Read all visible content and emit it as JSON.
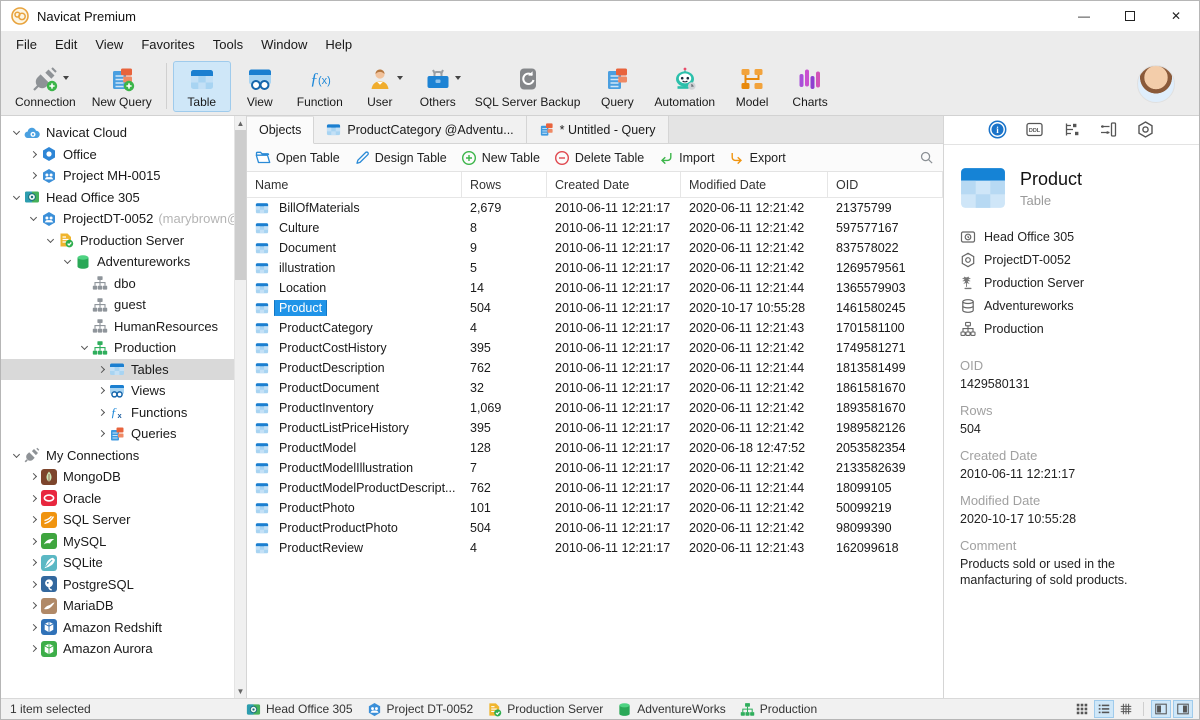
{
  "window": {
    "title": "Navicat Premium",
    "controls": {
      "minimize": "minimize",
      "maximize": "maximize",
      "close": "close"
    }
  },
  "menu": {
    "items": [
      "File",
      "Edit",
      "View",
      "Favorites",
      "Tools",
      "Window",
      "Help"
    ]
  },
  "toolbar": {
    "buttons": [
      {
        "label": "Connection",
        "icon": "connection",
        "caret": true,
        "active": false
      },
      {
        "label": "New Query",
        "icon": "new-query",
        "caret": false,
        "active": false
      },
      {
        "label": "Table",
        "icon": "table-lg",
        "caret": false,
        "active": true
      },
      {
        "label": "View",
        "icon": "view-lg",
        "caret": false,
        "active": false
      },
      {
        "label": "Function",
        "icon": "function",
        "caret": false,
        "active": false
      },
      {
        "label": "User",
        "icon": "user",
        "caret": true,
        "active": false
      },
      {
        "label": "Others",
        "icon": "others",
        "caret": true,
        "active": false
      },
      {
        "label": "SQL Server Backup",
        "icon": "backup",
        "caret": false,
        "active": false
      },
      {
        "label": "Query",
        "icon": "query",
        "caret": false,
        "active": false
      },
      {
        "label": "Automation",
        "icon": "automation",
        "caret": false,
        "active": false
      },
      {
        "label": "Model",
        "icon": "model",
        "caret": false,
        "active": false
      },
      {
        "label": "Charts",
        "icon": "charts",
        "caret": false,
        "active": false
      }
    ]
  },
  "sidebar": {
    "items": [
      {
        "label": "Navicat Cloud",
        "icon": "cloud",
        "depth": 0,
        "chevron": "down",
        "selected": false
      },
      {
        "label": "Office",
        "icon": "hex-office",
        "depth": 1,
        "chevron": "right",
        "selected": false
      },
      {
        "label": "Project MH-0015",
        "icon": "project",
        "depth": 1,
        "chevron": "right",
        "selected": false
      },
      {
        "label": "Head Office 305",
        "icon": "headoffice",
        "depth": 0,
        "chevron": "down",
        "selected": false
      },
      {
        "label": "ProjectDT-0052",
        "secondary": "(marybrown@",
        "icon": "project",
        "depth": 1,
        "chevron": "down",
        "selected": false
      },
      {
        "label": "Production Server",
        "icon": "prodserver",
        "depth": 2,
        "chevron": "down",
        "selected": false
      },
      {
        "label": "Adventureworks",
        "icon": "db-green",
        "depth": 3,
        "chevron": "down",
        "selected": false
      },
      {
        "label": "dbo",
        "icon": "schema-gray",
        "depth": 4,
        "chevron": "none",
        "selected": false
      },
      {
        "label": "guest",
        "icon": "schema-gray",
        "depth": 4,
        "chevron": "none",
        "selected": false
      },
      {
        "label": "HumanResources",
        "icon": "schema-gray",
        "depth": 4,
        "chevron": "none",
        "selected": false
      },
      {
        "label": "Production",
        "icon": "schema-green",
        "depth": 4,
        "chevron": "down",
        "selected": false
      },
      {
        "label": "Tables",
        "icon": "table",
        "depth": 5,
        "chevron": "right",
        "selected": true
      },
      {
        "label": "Views",
        "icon": "view",
        "depth": 5,
        "chevron": "right",
        "selected": false
      },
      {
        "label": "Functions",
        "icon": "functions",
        "depth": 5,
        "chevron": "right",
        "selected": false
      },
      {
        "label": "Queries",
        "icon": "queries",
        "depth": 5,
        "chevron": "right",
        "selected": false
      },
      {
        "label": "My Connections",
        "icon": "plug",
        "depth": 0,
        "chevron": "down",
        "selected": false
      },
      {
        "label": "MongoDB",
        "icon": "mongodb",
        "depth": 1,
        "chevron": "right",
        "selected": false
      },
      {
        "label": "Oracle",
        "icon": "oracle",
        "depth": 1,
        "chevron": "right",
        "selected": false
      },
      {
        "label": "SQL Server",
        "icon": "sqlserver",
        "depth": 1,
        "chevron": "right",
        "selected": false
      },
      {
        "label": "MySQL",
        "icon": "mysql",
        "depth": 1,
        "chevron": "right",
        "selected": false
      },
      {
        "label": "SQLite",
        "icon": "sqlite",
        "depth": 1,
        "chevron": "right",
        "selected": false
      },
      {
        "label": "PostgreSQL",
        "icon": "postgresql",
        "depth": 1,
        "chevron": "right",
        "selected": false
      },
      {
        "label": "MariaDB",
        "icon": "mariadb",
        "depth": 1,
        "chevron": "right",
        "selected": false
      },
      {
        "label": "Amazon Redshift",
        "icon": "redshift",
        "depth": 1,
        "chevron": "right",
        "selected": false
      },
      {
        "label": "Amazon Aurora",
        "icon": "aurora",
        "depth": 1,
        "chevron": "right",
        "selected": false
      }
    ]
  },
  "tabs": [
    {
      "label": "Objects",
      "icon": "none",
      "active": true
    },
    {
      "label": "ProductCategory @Adventu...",
      "icon": "table",
      "active": false
    },
    {
      "label": "* Untitled - Query",
      "icon": "queries",
      "active": false
    }
  ],
  "object_toolbar": {
    "buttons": [
      {
        "label": "Open Table",
        "icon": "folder-open"
      },
      {
        "label": "Design Table",
        "icon": "pencil"
      },
      {
        "label": "New Table",
        "icon": "plus-circle"
      },
      {
        "label": "Delete Table",
        "icon": "minus-circle"
      },
      {
        "label": "Import",
        "icon": "import"
      },
      {
        "label": "Export",
        "icon": "export"
      }
    ]
  },
  "table": {
    "columns": [
      "Name",
      "Rows",
      "Created Date",
      "Modified Date",
      "OID"
    ],
    "rows": [
      {
        "name": "BillOfMaterials",
        "rows": "2,679",
        "created": "2010-06-11 12:21:17",
        "modified": "2020-06-11 12:21:42",
        "oid": "21375799",
        "selected": false
      },
      {
        "name": "Culture",
        "rows": "8",
        "created": "2010-06-11 12:21:17",
        "modified": "2020-06-11 12:21:42",
        "oid": "597577167",
        "selected": false
      },
      {
        "name": "Document",
        "rows": "9",
        "created": "2010-06-11 12:21:17",
        "modified": "2020-06-11 12:21:42",
        "oid": "837578022",
        "selected": false
      },
      {
        "name": "illustration",
        "rows": "5",
        "created": "2010-06-11 12:21:17",
        "modified": "2020-06-11 12:21:42",
        "oid": "1269579561",
        "selected": false
      },
      {
        "name": "Location",
        "rows": "14",
        "created": "2010-06-11 12:21:17",
        "modified": "2020-06-11 12:21:44",
        "oid": "1365579903",
        "selected": false
      },
      {
        "name": "Product",
        "rows": "504",
        "created": "2010-06-11 12:21:17",
        "modified": "2020-10-17 10:55:28",
        "oid": "1461580245",
        "selected": true
      },
      {
        "name": "ProductCategory",
        "rows": "4",
        "created": "2010-06-11 12:21:17",
        "modified": "2020-06-11 12:21:43",
        "oid": "1701581100",
        "selected": false
      },
      {
        "name": "ProductCostHistory",
        "rows": "395",
        "created": "2010-06-11 12:21:17",
        "modified": "2020-06-11 12:21:42",
        "oid": "1749581271",
        "selected": false
      },
      {
        "name": "ProductDescription",
        "rows": "762",
        "created": "2010-06-11 12:21:17",
        "modified": "2020-06-11 12:21:44",
        "oid": "1813581499",
        "selected": false
      },
      {
        "name": "ProductDocument",
        "rows": "32",
        "created": "2010-06-11 12:21:17",
        "modified": "2020-06-11 12:21:42",
        "oid": "1861581670",
        "selected": false
      },
      {
        "name": "ProductInventory",
        "rows": "1,069",
        "created": "2010-06-11 12:21:17",
        "modified": "2020-06-11 12:21:42",
        "oid": "1893581670",
        "selected": false
      },
      {
        "name": "ProductListPriceHistory",
        "rows": "395",
        "created": "2010-06-11 12:21:17",
        "modified": "2020-06-11 12:21:42",
        "oid": "1989582126",
        "selected": false
      },
      {
        "name": "ProductModel",
        "rows": "128",
        "created": "2010-06-11 12:21:17",
        "modified": "2020-06-18 12:47:52",
        "oid": "2053582354",
        "selected": false
      },
      {
        "name": "ProductModelIllustration",
        "rows": "7",
        "created": "2010-06-11 12:21:17",
        "modified": "2020-06-11 12:21:42",
        "oid": "2133582639",
        "selected": false
      },
      {
        "name": "ProductModelProductDescript...",
        "rows": "762",
        "created": "2010-06-11 12:21:17",
        "modified": "2020-06-11 12:21:44",
        "oid": "18099105",
        "selected": false
      },
      {
        "name": "ProductPhoto",
        "rows": "101",
        "created": "2010-06-11 12:21:17",
        "modified": "2020-06-11 12:21:42",
        "oid": "50099219",
        "selected": false
      },
      {
        "name": "ProductProductPhoto",
        "rows": "504",
        "created": "2010-06-11 12:21:17",
        "modified": "2020-06-11 12:21:42",
        "oid": "98099390",
        "selected": false
      },
      {
        "name": "ProductReview",
        "rows": "4",
        "created": "2010-06-11 12:21:17",
        "modified": "2020-06-11 12:21:43",
        "oid": "162099618",
        "selected": false
      }
    ]
  },
  "right_panel": {
    "tools": [
      {
        "icon": "info",
        "active": true
      },
      {
        "icon": "ddl",
        "active": false
      },
      {
        "icon": "struct1",
        "active": false
      },
      {
        "icon": "struct2",
        "active": false
      },
      {
        "icon": "hexgear",
        "active": false
      }
    ],
    "title": "Product",
    "subtitle": "Table",
    "context": [
      {
        "icon": "bc-card",
        "label": "Head Office 305"
      },
      {
        "icon": "bc-hex",
        "label": "ProjectDT-0052"
      },
      {
        "icon": "bc-server",
        "label": "Production Server"
      },
      {
        "icon": "bc-db",
        "label": "Adventureworks"
      },
      {
        "icon": "bc-schema",
        "label": "Production"
      }
    ],
    "fields": [
      {
        "label": "OID",
        "value": "1429580131"
      },
      {
        "label": "Rows",
        "value": "504"
      },
      {
        "label": "Created Date",
        "value": "2010-06-11 12:21:17"
      },
      {
        "label": "Modified Date",
        "value": "2020-10-17 10:55:28"
      },
      {
        "label": "Comment",
        "value": "Products sold or used in the manfacturing of sold products."
      }
    ]
  },
  "status_bar": {
    "left": "1 item selected",
    "crumbs": [
      {
        "icon": "headoffice",
        "label": "Head Office 305"
      },
      {
        "icon": "project",
        "label": "Project DT-0052"
      },
      {
        "icon": "prodserver",
        "label": "Production Server"
      },
      {
        "icon": "db-green",
        "label": "AdventureWorks"
      },
      {
        "icon": "schema-green",
        "label": "Production"
      }
    ],
    "view_buttons": [
      {
        "icon": "grid9",
        "active": false
      },
      {
        "icon": "list",
        "active": true
      },
      {
        "icon": "hashgrid",
        "active": false
      }
    ],
    "panel_buttons": [
      {
        "icon": "panel-left",
        "active": true
      },
      {
        "icon": "panel-right",
        "active": true
      }
    ]
  },
  "colors": {
    "accent": "#2094e8",
    "toolbar_active_bg": "#cfe7f8",
    "tree_selected_bg": "#d9d9d9"
  }
}
